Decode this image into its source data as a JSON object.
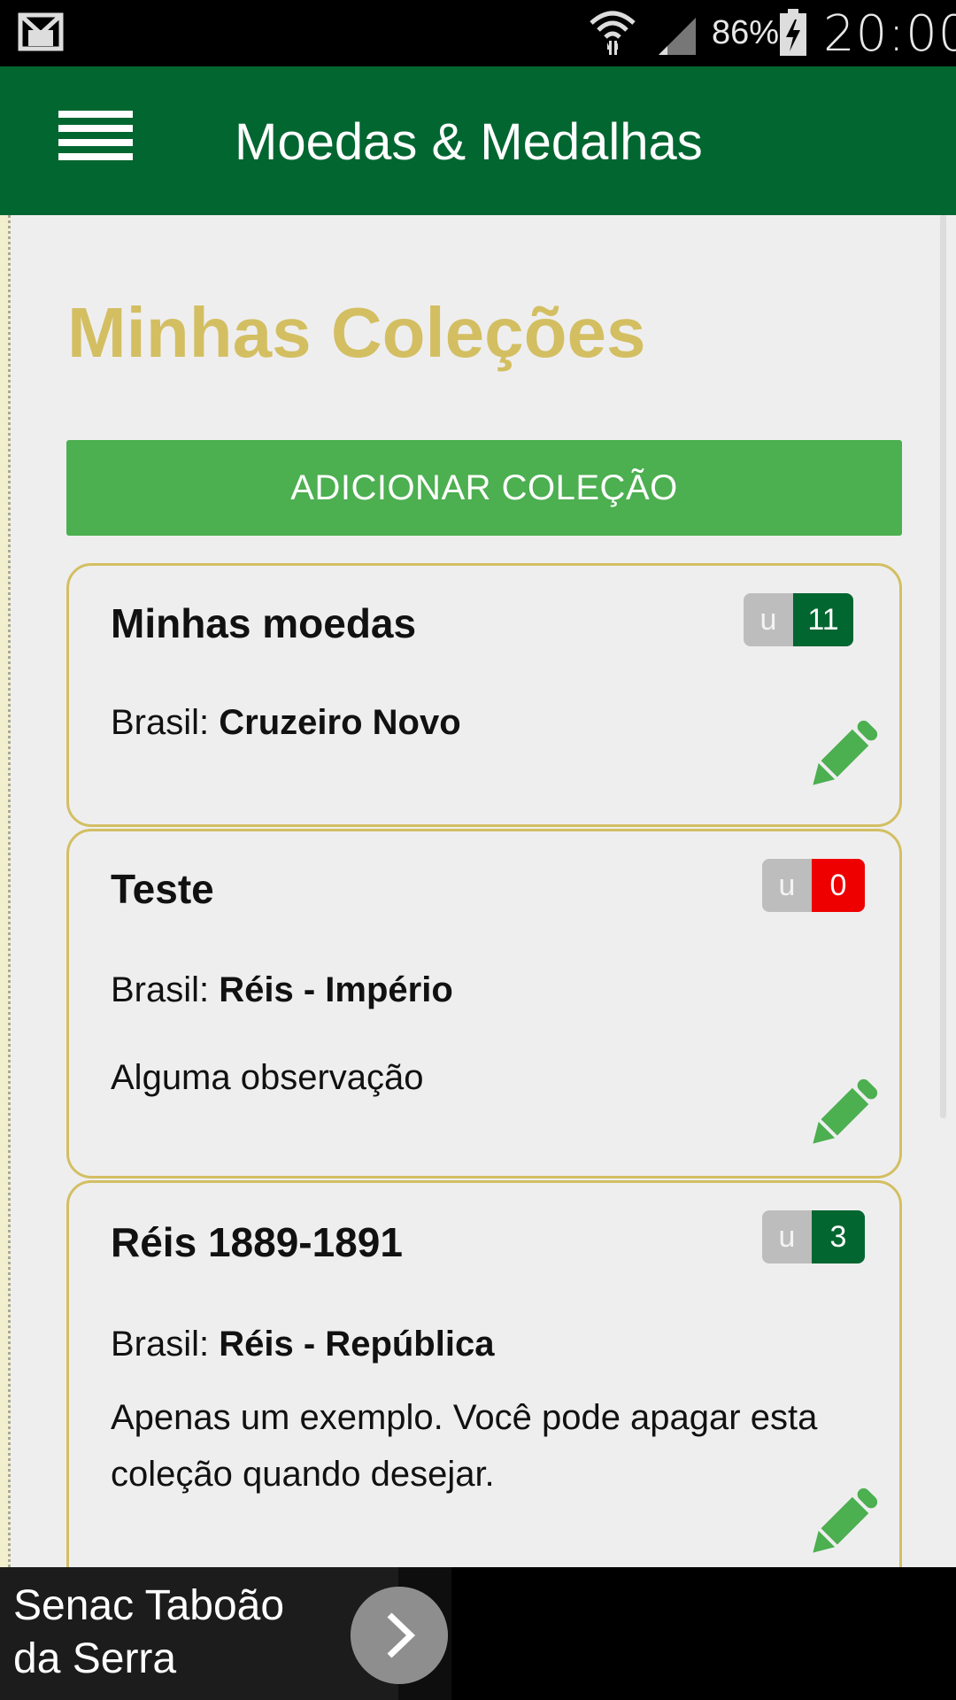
{
  "status_bar": {
    "battery": "86%",
    "time": "20:00"
  },
  "app_bar": {
    "title": "Moedas & Medalhas"
  },
  "page": {
    "title": "Minhas Coleções",
    "add_button": "ADICIONAR COLEÇÃO"
  },
  "collections": [
    {
      "name": "Minhas moedas",
      "badge_u": "u",
      "count": "11",
      "count_color": "#026630",
      "country": "Brasil:",
      "series": "Cruzeiro Novo",
      "note": ""
    },
    {
      "name": "Teste",
      "badge_u": "u",
      "count": "0",
      "count_color": "#ee0000",
      "country": "Brasil:",
      "series": "Réis - Império",
      "note": "Alguma observação"
    },
    {
      "name": "Réis 1889-1891",
      "badge_u": "u",
      "count": "3",
      "count_color": "#026630",
      "country": "Brasil:",
      "series": "Réis - República",
      "note": "Apenas um exemplo. Você pode apagar esta coleção quando desejar."
    }
  ],
  "ad": {
    "text": "Senac Taboão da Serra"
  },
  "colors": {
    "primary": "#026630",
    "accent_gold": "#d3bf62",
    "button_green": "#4caf50"
  },
  "icons": [
    "gmail-icon",
    "wifi-icon",
    "signal-icon",
    "battery-charging-icon",
    "menu-icon",
    "pencil-icon",
    "chevron-right-icon"
  ]
}
